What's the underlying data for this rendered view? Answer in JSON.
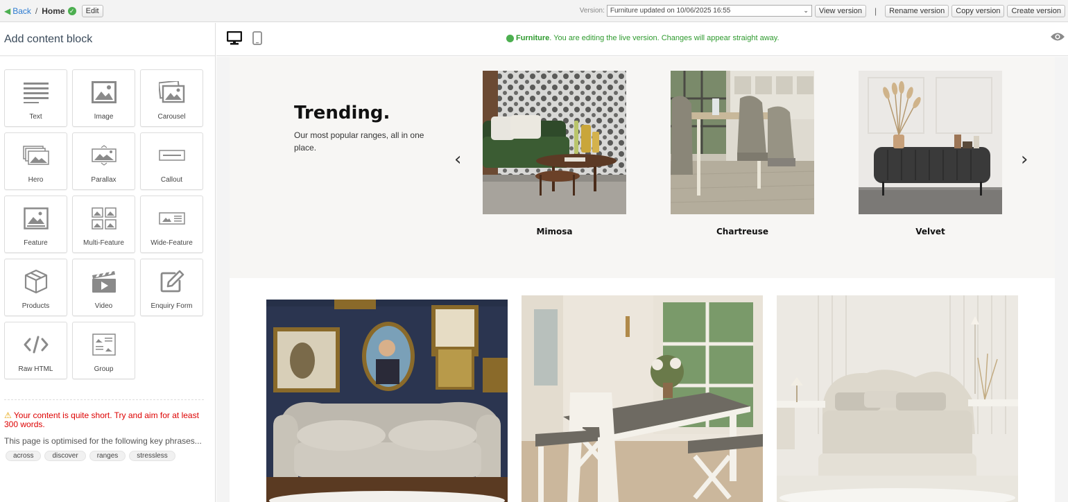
{
  "topbar": {
    "back_label": "Back",
    "separator": "/",
    "home_label": "Home",
    "edit_label": "Edit",
    "version_label": "Version:",
    "version_value": "Furniture updated on 10/06/2025 16:55",
    "view_version": "View version",
    "pipe": "|",
    "rename_version": "Rename version",
    "copy_version": "Copy version",
    "create_version": "Create version"
  },
  "sidebar": {
    "title": "Add content block",
    "blocks": [
      {
        "label": "Text",
        "icon": "text-icon"
      },
      {
        "label": "Image",
        "icon": "image-icon"
      },
      {
        "label": "Carousel",
        "icon": "carousel-icon"
      },
      {
        "label": "Hero",
        "icon": "hero-icon"
      },
      {
        "label": "Parallax",
        "icon": "parallax-icon"
      },
      {
        "label": "Callout",
        "icon": "callout-icon"
      },
      {
        "label": "Feature",
        "icon": "feature-icon"
      },
      {
        "label": "Multi-Feature",
        "icon": "multi-feature-icon"
      },
      {
        "label": "Wide-Feature",
        "icon": "wide-feature-icon"
      },
      {
        "label": "Products",
        "icon": "products-icon"
      },
      {
        "label": "Video",
        "icon": "video-icon"
      },
      {
        "label": "Enquiry Form",
        "icon": "enquiry-form-icon"
      },
      {
        "label": "Raw HTML",
        "icon": "code-icon"
      },
      {
        "label": "Group",
        "icon": "group-icon"
      }
    ],
    "warning": "Your content is quite short. Try and aim for at least 300 words.",
    "optimised": "This page is optimised for the following key phrases...",
    "tags": [
      "across",
      "discover",
      "ranges",
      "stressless"
    ]
  },
  "main_header": {
    "status_name": "Furniture",
    "status_text": ". You are editing the live version. Changes will appear straight away."
  },
  "content": {
    "trending_title": "Trending.",
    "trending_subtitle": "Our most popular ranges, all in one place.",
    "prev_arrow": "‹",
    "next_arrow": "›",
    "cards": [
      {
        "name": "Mimosa"
      },
      {
        "name": "Chartreuse"
      },
      {
        "name": "Velvet"
      }
    ]
  },
  "colors": {
    "link": "#2c7bd1",
    "success": "#4caf50",
    "warning": "#dd0000"
  }
}
